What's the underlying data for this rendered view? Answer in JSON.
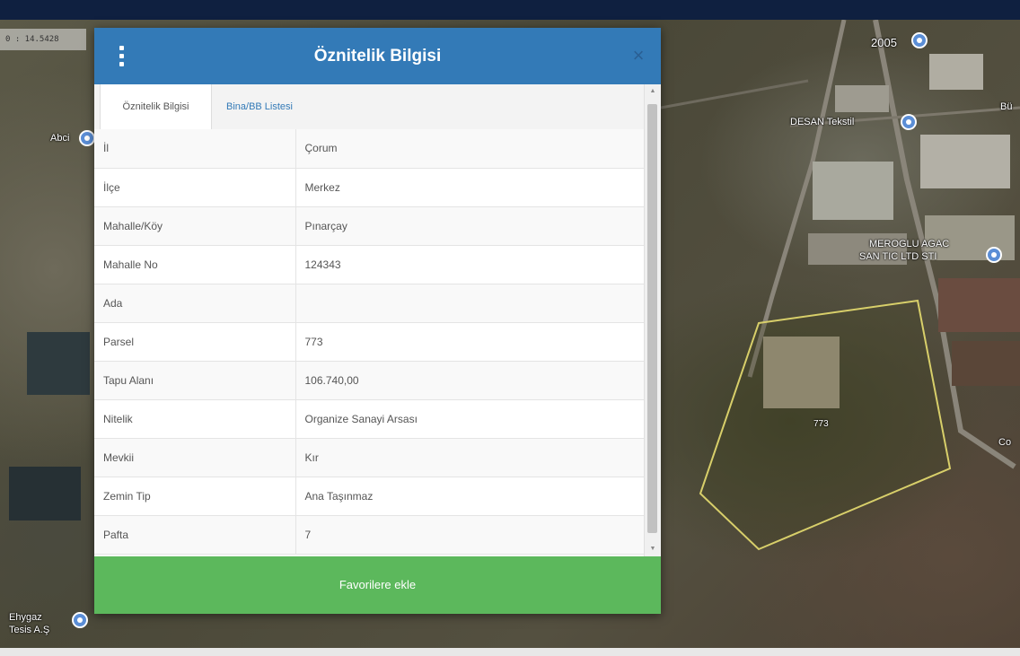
{
  "map": {
    "scale_text": "0 : 14.5428",
    "labels": {
      "top_right_number": "2005",
      "left_place": "Abci",
      "company_1": "DESAN Tekstil",
      "company_2_line1": "MEROGLU AGAC",
      "company_2_line2": "SAN TIC LTD STI",
      "parcel_label": "773",
      "bottom_left_place_line1": "Ehygaz",
      "bottom_left_place_line2": "Tesis A.Ş",
      "right_edge_1": "Bü",
      "right_edge_2": "Co"
    },
    "parcel_outline_color": "#d8cf6a"
  },
  "dialog": {
    "title": "Öznitelik Bilgisi",
    "close_symbol": "×",
    "tabs": [
      {
        "label": "Öznitelik Bilgisi",
        "active": true
      },
      {
        "label": "Bina/BB Listesi",
        "active": false
      }
    ],
    "rows": [
      {
        "key": "İl",
        "value": "Çorum"
      },
      {
        "key": "İlçe",
        "value": "Merkez"
      },
      {
        "key": "Mahalle/Köy",
        "value": "Pınarçay"
      },
      {
        "key": "Mahalle No",
        "value": "124343"
      },
      {
        "key": "Ada",
        "value": ""
      },
      {
        "key": "Parsel",
        "value": "773"
      },
      {
        "key": "Tapu Alanı",
        "value": "106.740,00"
      },
      {
        "key": "Nitelik",
        "value": "Organize Sanayi Arsası"
      },
      {
        "key": "Mevkii",
        "value": "Kır"
      },
      {
        "key": "Zemin Tip",
        "value": "Ana Taşınmaz"
      },
      {
        "key": "Pafta",
        "value": "7"
      }
    ],
    "favorite_button": "Favorilere ekle"
  },
  "colors": {
    "header": "#337ab7",
    "button": "#5cb85c",
    "tab_link": "#337ab7"
  }
}
